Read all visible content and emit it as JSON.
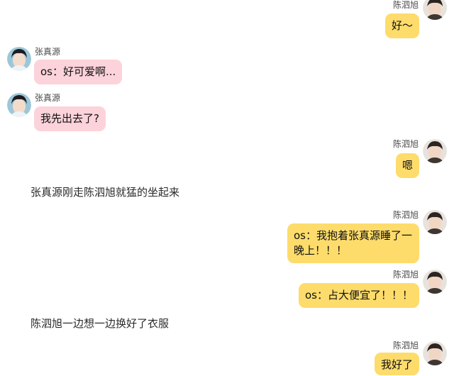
{
  "senders": {
    "right": "陈泗旭",
    "left": "张真源"
  },
  "messages": [
    {
      "side": "right",
      "sender": "陈泗旭",
      "text": "好～"
    },
    {
      "side": "left",
      "sender": "张真源",
      "text": "os：好可爱啊..."
    },
    {
      "side": "left",
      "sender": "张真源",
      "text": "我先出去了?"
    },
    {
      "side": "right",
      "sender": "陈泗旭",
      "text": "嗯"
    },
    {
      "side": "narration",
      "text": "张真源刚走陈泗旭就猛的坐起来"
    },
    {
      "side": "right",
      "sender": "陈泗旭",
      "text": "os：我抱着张真源睡了一晚上！！！"
    },
    {
      "side": "right",
      "sender": "陈泗旭",
      "text": "os：占大便宜了！！！"
    },
    {
      "side": "narration",
      "text": "陈泗旭一边想一边换好了衣服"
    },
    {
      "side": "right",
      "sender": "陈泗旭",
      "text": "我好了"
    }
  ],
  "colors": {
    "left_bubble": "#fcd3db",
    "right_bubble": "#fddc6c",
    "background": "#ffffff"
  },
  "icons": {
    "right_avatar": "avatar-chen-sixu-icon",
    "left_avatar": "avatar-zhang-zhenyuan-icon"
  }
}
